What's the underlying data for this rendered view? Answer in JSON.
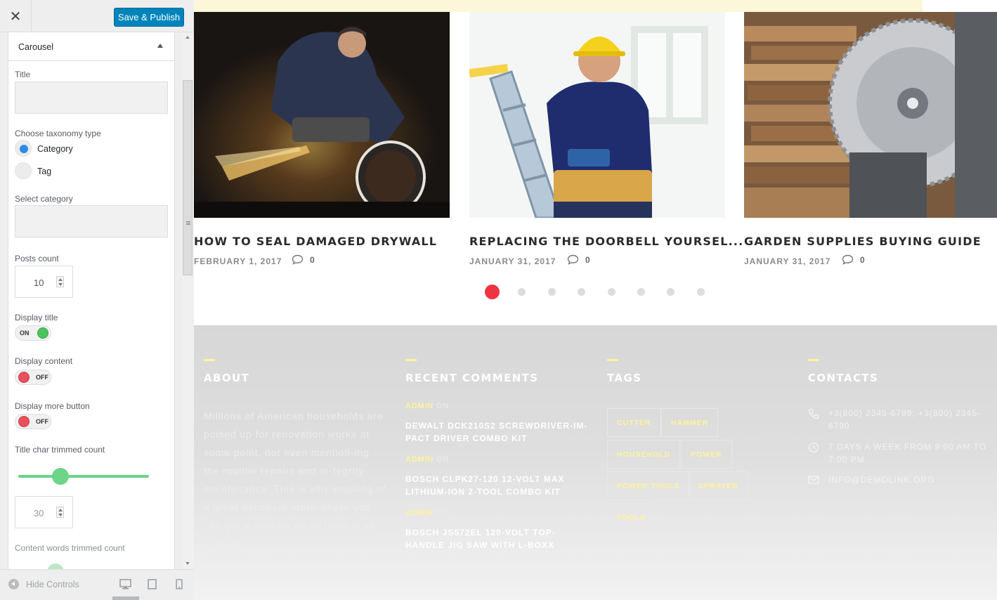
{
  "customizer": {
    "close_label": "✕",
    "publish_label": "Save & Publish",
    "section_title": "Carousel",
    "title_label": "Title",
    "title_value": "",
    "taxonomy_label": "Choose taxonomy type",
    "taxonomy_options": [
      "Category",
      "Tag"
    ],
    "taxonomy_selected": "Category",
    "category_label": "Select category",
    "category_value": "",
    "posts_count_label": "Posts count",
    "posts_count_value": "10",
    "display_title_label": "Display title",
    "display_title_state": "ON",
    "display_content_label": "Display content",
    "display_content_state": "OFF",
    "display_more_label": "Display more button",
    "display_more_state": "OFF",
    "title_trim_label": "Title char trimmed count",
    "title_trim_value": "30",
    "content_trim_label": "Content words trimmed count",
    "hide_controls_label": "Hide Controls"
  },
  "carousel": {
    "posts": [
      {
        "title": "HOW TO SEAL DAMAGED DRYWALL",
        "date": "FEBRUARY 1, 2017",
        "comments": "0",
        "image": "welder-grinding-pipe"
      },
      {
        "title": "REPLACING THE DOORBELL YOURSEL...",
        "date": "JANUARY 31, 2017",
        "comments": "0",
        "image": "worker-on-ladder-with-drill"
      },
      {
        "title": "GARDEN SUPPLIES BUYING GUIDE",
        "date": "JANUARY 31, 2017",
        "comments": "0",
        "image": "circular-saw-and-lumber"
      }
    ],
    "page_count": 8,
    "active_page": 1
  },
  "footer": {
    "about": {
      "heading": "ABOUT",
      "text": "Millions of American households are poised up for renovation works at some point, not even mention-ing the routine repairs and in-tegrity maintenance. This is why knowing of a great hardware store where you can get a bargain on all tools is so important!"
    },
    "recent_comments": {
      "heading": "RECENT COMMENTS",
      "items": [
        {
          "author": "ADMIN",
          "on": "ON",
          "post": "DEWALT DCK210S2 SCREWDRIVER-IM-PACT DRIVER COMBO KIT"
        },
        {
          "author": "ADMIN",
          "on": "ON",
          "post": "BOSCH CLPK27-120 12-VOLT MAX LITHIUM-ION 2-TOOL COMBO KIT"
        },
        {
          "author": "ADMIN",
          "on": "ON",
          "post": "BOSCH JS572EL 120-VOLT TOP-HANDLE JIG SAW WITH L-BOXX"
        }
      ]
    },
    "tags": {
      "heading": "TAGS",
      "items": [
        "CUTTER",
        "HAMMER",
        "HOUSEHOLD",
        "POWER",
        "POWER TOOLS",
        "SPRAYER",
        "TOOLS"
      ]
    },
    "contacts": {
      "heading": "CONTACTS",
      "phone": "+3(800) 2345-6789; +3(800) 2345-6790",
      "hours": "7 DAYS A WEEK FROM 9:00 AM TO 7:00 PM",
      "email": "INFO@DEMOLINK.ORG"
    }
  },
  "colors": {
    "publish_blue": "#0085ba",
    "toggle_on": "#4cc35d",
    "toggle_off": "#e8505b",
    "slider_green": "#6dd488",
    "dot_active": "#ee3342",
    "footer_accent": "#fff39a"
  }
}
